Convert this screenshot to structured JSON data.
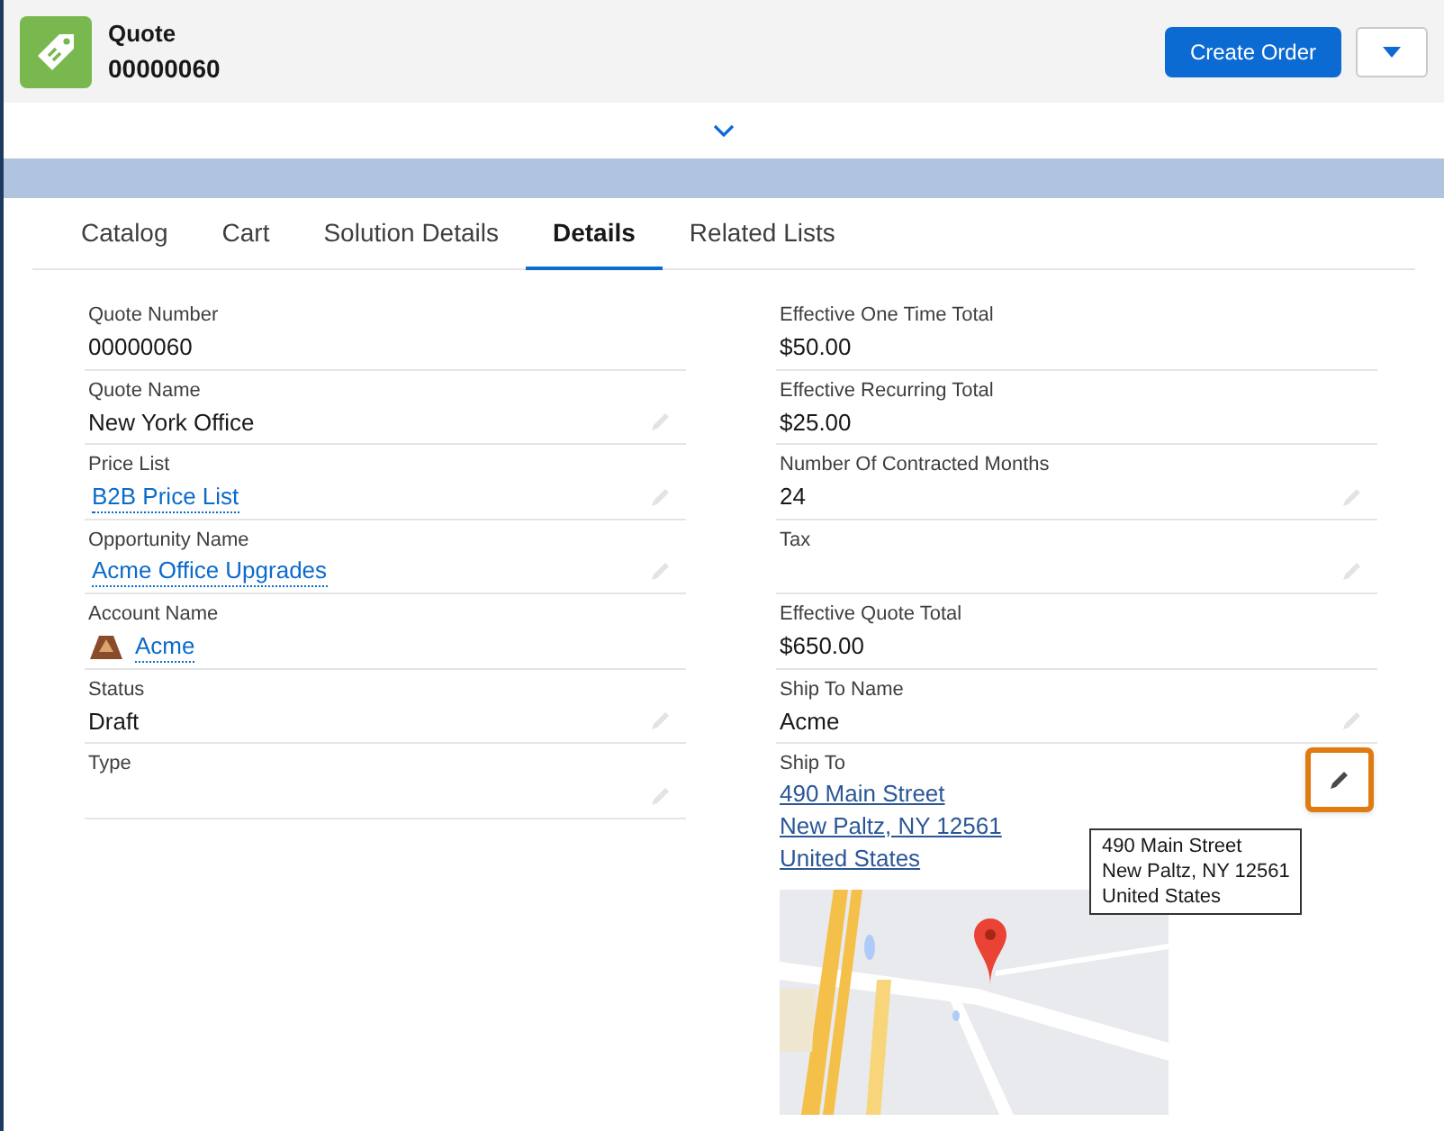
{
  "header": {
    "object_type": "Quote",
    "record_number": "00000060",
    "buttons": [
      {
        "label": "Create Order"
      }
    ]
  },
  "tabs": [
    {
      "label": "Catalog",
      "selected": false
    },
    {
      "label": "Cart",
      "selected": false
    },
    {
      "label": "Solution Details",
      "selected": false
    },
    {
      "label": "Details",
      "selected": true
    },
    {
      "label": "Related Lists",
      "selected": false
    }
  ],
  "left_fields": [
    {
      "label": "Quote Number",
      "value": "00000060",
      "kind": "text",
      "editable": false
    },
    {
      "label": "Quote Name",
      "value": "New York Office",
      "kind": "text",
      "editable": true
    },
    {
      "label": "Price List",
      "value": "B2B Price List",
      "kind": "link",
      "editable": true
    },
    {
      "label": "Opportunity Name",
      "value": "Acme Office Upgrades",
      "kind": "link",
      "editable": true
    },
    {
      "label": "Account Name",
      "value": "Acme",
      "kind": "account",
      "editable": false
    },
    {
      "label": "Status",
      "value": "Draft",
      "kind": "text",
      "editable": true
    },
    {
      "label": "Type",
      "kind": "text",
      "editable": true
    }
  ],
  "right_fields": [
    {
      "label": "Effective One Time Total",
      "value": "$50.00",
      "kind": "text",
      "editable": false
    },
    {
      "label": "Effective Recurring Total",
      "value": "$25.00",
      "kind": "text",
      "editable": false
    },
    {
      "label": "Number Of Contracted Months",
      "value": "24",
      "kind": "text",
      "editable": true
    },
    {
      "label": "Tax",
      "kind": "text",
      "editable": true
    },
    {
      "label": "Effective Quote Total",
      "value": "$650.00",
      "kind": "text",
      "editable": false
    },
    {
      "label": "Ship To Name",
      "value": "Acme",
      "kind": "text",
      "editable": true
    },
    {
      "label": "Ship To",
      "lines": [
        "490 Main Street",
        "New Paltz, NY 12561",
        "United States"
      ],
      "kind": "address",
      "editable": true,
      "highlighted": true,
      "tooltip": [
        "490 Main Street",
        "New Paltz, NY 12561",
        "United States"
      ]
    }
  ]
}
